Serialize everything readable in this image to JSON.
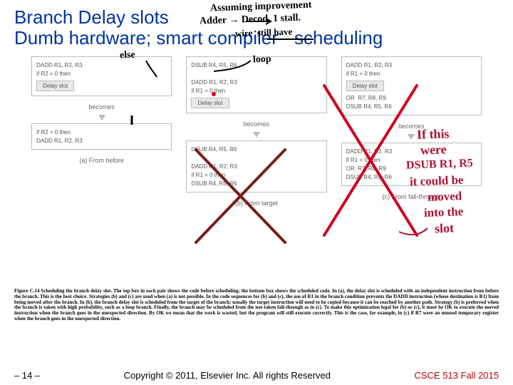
{
  "title_line1": "Branch Delay slots",
  "title_line2": "Dumb hardware; smart compiler - scheduling",
  "cols": {
    "a": {
      "top": {
        "l1": "DADD R1, R2, R3",
        "l2": "if R2 = 0 then",
        "slot": "Delay slot"
      },
      "becomes": "becomes",
      "bot": {
        "l1": "if R2 = 0 then",
        "l2": "DADD R1, R2, R3"
      },
      "cap": "(a) From before"
    },
    "b": {
      "top": {
        "l1": "DSUB R4, R5, R6",
        "gap": " ",
        "l2": "DADD R1, R2, R3",
        "l3": "if R1 = 0 then",
        "slot": "Delay slot"
      },
      "becomes": "becomes",
      "bot": {
        "l1": "DSUB R4, R5, R6",
        "gap": " ",
        "l2": "DADD R1, R2, R3",
        "l3": "if R1 = 0 then",
        "l4": "DSUB R4, R5, R6"
      },
      "cap": "(b) From target"
    },
    "c": {
      "top": {
        "l1": "DADD R1, R2, R3",
        "l2": "if R1 = 0 then",
        "slot": "Delay slot",
        "l3": "OR  R7, R8, R9",
        "l4": "DSUB R4, R5, R6"
      },
      "becomes": "becomes",
      "bot": {
        "l1": "DADD R1, R2, R3",
        "l2": "if R1 = 0 then",
        "l3": "OR  R7, R8, R9",
        "l4": "DSUB R4, R5, R6"
      },
      "cap": "(c) From fall-through"
    }
  },
  "caption": "Figure C.14  Scheduling the branch delay slot. The top box in each pair shows the code before scheduling; the bottom box shows the scheduled code. In (a), the delay slot is scheduled with an independent instruction from before the branch. This is the best choice. Strategies (b) and (c) are used when (a) is not possible. In the code sequences for (b) and (c), the use of R1 in the branch condition prevents the DADD instruction (whose destination is R1) from being moved after the branch. In (b), the branch delay slot is scheduled from the target of the branch; usually the target instruction will need to be copied because it can be reached by another path. Strategy (b) is preferred when the branch is taken with high probability, such as a loop branch. Finally, the branch may be scheduled from the not-taken fall-through as in (c). To make this optimization legal for (b) or (c), it must be OK to execute the moved instruction when the branch goes in the unexpected direction. By OK we mean that the work is wasted, but the program will still execute correctly. This is the case, for example, in (c) if R7 were an unused temporary register when the branch goes in the unexpected direction.",
  "footer": {
    "page": "– 14 –",
    "copy": "Copyright © 2011, Elsevier Inc. All rights Reserved",
    "course": "CSCE 513 Fall 2015"
  },
  "ink": {
    "top1": "Assuming improvement",
    "top2": "Adder → Decod  1 stall.",
    "top3": "wire  still have",
    "else": "else",
    "loop": "loop",
    "side1": "If this",
    "side2": "were",
    "side3": "DSUB R1, R5",
    "side4": "it could be",
    "side5": "moved",
    "side6": "into the",
    "side7": "slot"
  }
}
